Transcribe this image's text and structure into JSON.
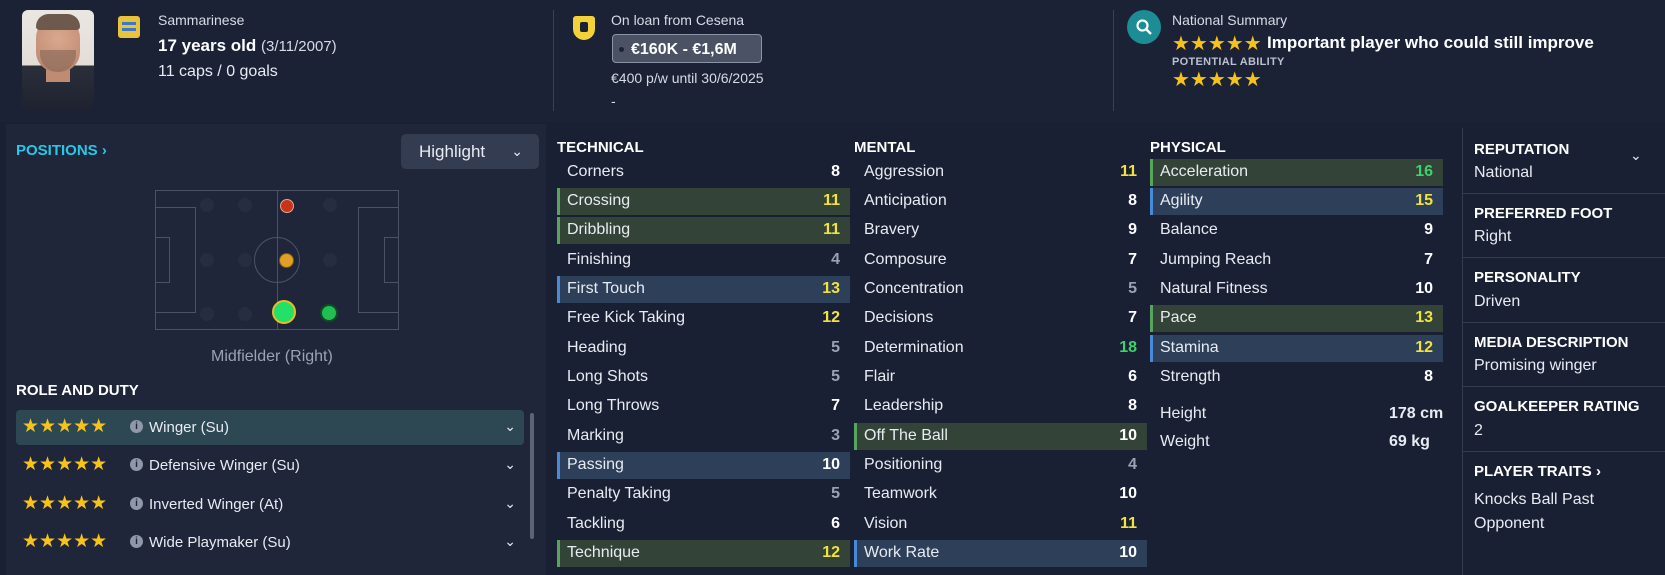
{
  "header": {
    "nationality": "Sammarinese",
    "age": "17 years old",
    "dob": "(3/11/2007)",
    "caps": "11 caps / 0 goals",
    "loan": "On loan from Cesena",
    "value": "€160K - €1,6M",
    "wage": "€400 p/w until 30/6/2025",
    "dash": "-",
    "summary_title": "National Summary",
    "summary_text": "Important player who could still improve",
    "potential_label": "POTENTIAL ABILITY",
    "current_stars": "★★★★★",
    "potential_stars": "★★★★★"
  },
  "positions": {
    "title": "POSITIONS ›",
    "highlight": "Highlight",
    "position_label": "Midfielder (Right)",
    "role_title": "ROLE AND DUTY",
    "roles": [
      {
        "stars": "★★★★★",
        "name": "Winger (Su)"
      },
      {
        "stars": "★★★★★",
        "name": "Defensive Winger (Su)"
      },
      {
        "stars": "★★★★★",
        "name": "Inverted Winger (At)"
      },
      {
        "stars": "★★★★★",
        "name": "Wide Playmaker (Su)"
      }
    ]
  },
  "technical": {
    "title": "TECHNICAL",
    "rows": [
      {
        "name": "Corners",
        "value": "8"
      },
      {
        "name": "Crossing",
        "value": "11"
      },
      {
        "name": "Dribbling",
        "value": "11"
      },
      {
        "name": "Finishing",
        "value": "4"
      },
      {
        "name": "First Touch",
        "value": "13"
      },
      {
        "name": "Free Kick Taking",
        "value": "12"
      },
      {
        "name": "Heading",
        "value": "5"
      },
      {
        "name": "Long Shots",
        "value": "5"
      },
      {
        "name": "Long Throws",
        "value": "7"
      },
      {
        "name": "Marking",
        "value": "3"
      },
      {
        "name": "Passing",
        "value": "10"
      },
      {
        "name": "Penalty Taking",
        "value": "5"
      },
      {
        "name": "Tackling",
        "value": "6"
      },
      {
        "name": "Technique",
        "value": "12"
      }
    ]
  },
  "mental": {
    "title": "MENTAL",
    "rows": [
      {
        "name": "Aggression",
        "value": "11"
      },
      {
        "name": "Anticipation",
        "value": "8"
      },
      {
        "name": "Bravery",
        "value": "9"
      },
      {
        "name": "Composure",
        "value": "7"
      },
      {
        "name": "Concentration",
        "value": "5"
      },
      {
        "name": "Decisions",
        "value": "7"
      },
      {
        "name": "Determination",
        "value": "18"
      },
      {
        "name": "Flair",
        "value": "6"
      },
      {
        "name": "Leadership",
        "value": "8"
      },
      {
        "name": "Off The Ball",
        "value": "10"
      },
      {
        "name": "Positioning",
        "value": "4"
      },
      {
        "name": "Teamwork",
        "value": "10"
      },
      {
        "name": "Vision",
        "value": "11"
      },
      {
        "name": "Work Rate",
        "value": "10"
      }
    ]
  },
  "physical": {
    "title": "PHYSICAL",
    "rows": [
      {
        "name": "Acceleration",
        "value": "16"
      },
      {
        "name": "Agility",
        "value": "15"
      },
      {
        "name": "Balance",
        "value": "9"
      },
      {
        "name": "Jumping Reach",
        "value": "7"
      },
      {
        "name": "Natural Fitness",
        "value": "10"
      },
      {
        "name": "Pace",
        "value": "13"
      },
      {
        "name": "Stamina",
        "value": "12"
      },
      {
        "name": "Strength",
        "value": "8"
      }
    ],
    "height_label": "Height",
    "height_value": "178 cm",
    "weight_label": "Weight",
    "weight_value": "69 kg"
  },
  "info": {
    "reputation_title": "REPUTATION",
    "reputation_value": "National",
    "foot_title": "PREFERRED FOOT",
    "foot_value": "Right",
    "personality_title": "PERSONALITY",
    "personality_value": "Driven",
    "media_title": "MEDIA DESCRIPTION",
    "media_value": "Promising winger",
    "gk_title": "GOALKEEPER RATING",
    "gk_value": "2",
    "traits_title": "PLAYER TRAITS ›",
    "trait_line1": "Knocks Ball Past",
    "trait_line2": "Opponent"
  },
  "colors": {
    "value_low": "#9aa2b3",
    "value_mid": "#ffffff",
    "value_good": "#f1e33c",
    "value_high": "#39d46a"
  }
}
